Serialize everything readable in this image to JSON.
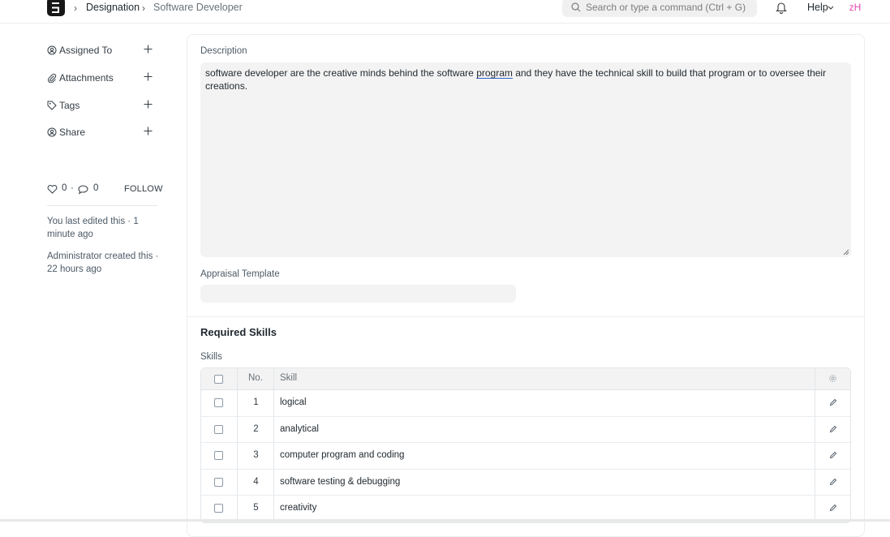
{
  "nav": {
    "breadcrumbs": [
      "Designation",
      "Software Developer"
    ],
    "search_placeholder": "Search or type a command (Ctrl + G)",
    "help_label": "Help",
    "avatar_initials": "zH",
    "avatar_color": "#e548b0"
  },
  "sidebar": {
    "items": [
      {
        "label": "Assigned To",
        "icon": "assign-icon"
      },
      {
        "label": "Attachments",
        "icon": "paperclip-icon"
      },
      {
        "label": "Tags",
        "icon": "tag-icon"
      },
      {
        "label": "Share",
        "icon": "share-icon"
      }
    ],
    "likes_count": "0",
    "comments_count": "0",
    "follow_label": "FOLLOW",
    "last_edited": "You last edited this · 1 minute ago",
    "created": "Administrator created this · 22 hours ago"
  },
  "form": {
    "description_label": "Description",
    "description_before": "software developer are the creative minds behind the software ",
    "description_flagged": "program",
    "description_after": " and they have the technical skill to build that program or to oversee their creations.",
    "appraisal_label": "Appraisal Template",
    "appraisal_value": "",
    "section_title": "Required Skills",
    "skills_label": "Skills"
  },
  "skills_table": {
    "headers": {
      "no": "No.",
      "skill": "Skill"
    },
    "rows": [
      {
        "no": "1",
        "skill": "logical"
      },
      {
        "no": "2",
        "skill": "analytical"
      },
      {
        "no": "3",
        "skill": "computer program and coding"
      },
      {
        "no": "4",
        "skill": "software testing & debugging"
      },
      {
        "no": "5",
        "skill": "creativity"
      }
    ]
  }
}
